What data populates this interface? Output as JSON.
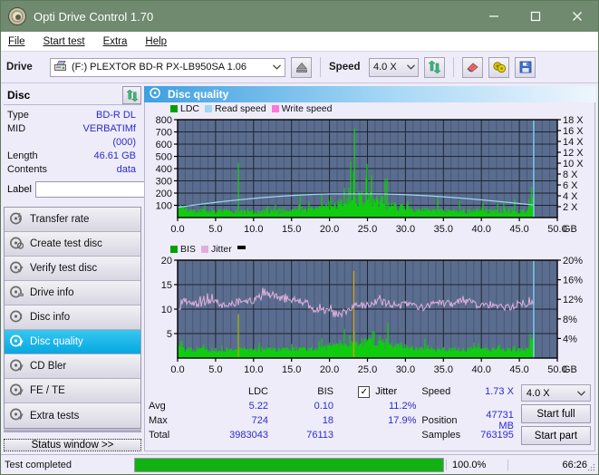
{
  "window": {
    "title": "Opti Drive Control 1.70",
    "icon": "disc-icon",
    "minimize": "minimize",
    "maximize": "maximize",
    "close": "close"
  },
  "menu": {
    "items": [
      {
        "label": "File",
        "mnemonic": "F"
      },
      {
        "label": "Start test",
        "mnemonic": "S"
      },
      {
        "label": "Extra",
        "mnemonic": "x"
      },
      {
        "label": "Help",
        "mnemonic": "H"
      }
    ]
  },
  "toolbar": {
    "drive_label": "Drive",
    "drive_value": "(F:)   PLEXTOR BD-R  PX-LB950SA 1.06",
    "drive_icon": "drive-icon",
    "eject_icon": "eject-icon",
    "speed_label": "Speed",
    "speed_value": "4.0 X",
    "refresh_icon": "refresh-icon",
    "eraser_icon": "eraser-icon",
    "bulb_icon": "bulb-icon",
    "save_icon": "save-icon"
  },
  "disc": {
    "header": "Disc",
    "refresh_icon": "refresh-icon",
    "rows": [
      {
        "key": "Type",
        "value": "BD-R DL"
      },
      {
        "key": "MID",
        "value": "VERBATIMf (000)"
      },
      {
        "key": "Length",
        "value": "46.61 GB"
      },
      {
        "key": "Contents",
        "value": "data"
      }
    ],
    "label_key": "Label",
    "label_value": "",
    "label_placeholder": "",
    "label_button_icon": "disc-icon"
  },
  "nav": {
    "items": [
      {
        "label": "Transfer rate",
        "icon": "disc-transfer-icon",
        "active": false
      },
      {
        "label": "Create test disc",
        "icon": "disc-create-icon",
        "active": false
      },
      {
        "label": "Verify test disc",
        "icon": "disc-verify-icon",
        "active": false
      },
      {
        "label": "Drive info",
        "icon": "disc-drive-icon",
        "active": false
      },
      {
        "label": "Disc info",
        "icon": "disc-info-icon",
        "active": false
      },
      {
        "label": "Disc quality",
        "icon": "disc-quality-icon",
        "active": true
      },
      {
        "label": "CD Bler",
        "icon": "disc-bler-icon",
        "active": false
      },
      {
        "label": "FE / TE",
        "icon": "disc-fete-icon",
        "active": false
      },
      {
        "label": "Extra tests",
        "icon": "disc-extra-icon",
        "active": false
      }
    ],
    "status_window": "Status window >>"
  },
  "content": {
    "header_title": "Disc quality",
    "header_icon": "disc-quality-icon"
  },
  "chart_data": [
    {
      "type": "line",
      "name": "ldc-chart",
      "title": "",
      "xlabel": "GB",
      "ylabel": "",
      "x": [
        0.0,
        5.0,
        10.0,
        15.0,
        20.0,
        25.0,
        30.0,
        35.0,
        40.0,
        45.0,
        50.0
      ],
      "xlim": [
        0,
        50
      ],
      "ylim": [
        0,
        800
      ],
      "ytick_labels": [
        "100",
        "200",
        "300",
        "400",
        "500",
        "600",
        "700",
        "800"
      ],
      "xtick_labels": [
        "0.0",
        "5.0",
        "10.0",
        "15.0",
        "20.0",
        "25.0",
        "30.0",
        "35.0",
        "40.0",
        "45.0",
        "50.0"
      ],
      "x_unit": "GB",
      "y2_tick_labels": [
        "2 X",
        "4 X",
        "6 X",
        "8 X",
        "10 X",
        "12 X",
        "14 X",
        "16 X",
        "18 X"
      ],
      "y2lim": [
        0,
        18
      ],
      "grid": true,
      "legend_position": "top-left",
      "series": [
        {
          "name": "LDC",
          "color": "#00c000",
          "type": "bar"
        },
        {
          "name": "Read speed",
          "color": "#9fd8f5",
          "type": "line"
        },
        {
          "name": "Write speed",
          "color": "#ff77dd",
          "type": "line"
        }
      ]
    },
    {
      "type": "line",
      "name": "bis-chart",
      "title": "",
      "xlabel": "GB",
      "ylabel": "",
      "xlim": [
        0,
        50
      ],
      "ylim": [
        0,
        20
      ],
      "ytick_labels": [
        "5",
        "10",
        "15",
        "20"
      ],
      "xtick_labels": [
        "0.0",
        "5.0",
        "10.0",
        "15.0",
        "20.0",
        "25.0",
        "30.0",
        "35.0",
        "40.0",
        "45.0",
        "50.0"
      ],
      "x_unit": "GB",
      "y2_tick_labels": [
        "4%",
        "8%",
        "12%",
        "16%",
        "20%"
      ],
      "y2lim": [
        0,
        20
      ],
      "grid": true,
      "legend_position": "top-left",
      "series": [
        {
          "name": "BIS",
          "color": "#00c000",
          "type": "bar"
        },
        {
          "name": "Jitter",
          "color": "#e0aedd",
          "type": "line"
        }
      ]
    }
  ],
  "stats": {
    "col_ldc": "LDC",
    "col_bis": "BIS",
    "col_jitter": "Jitter",
    "jitter_checked": true,
    "rows": [
      {
        "label": "Avg",
        "ldc": "5.22",
        "bis": "0.10",
        "jitter": "11.2%"
      },
      {
        "label": "Max",
        "ldc": "724",
        "bis": "18",
        "jitter": "17.9%"
      },
      {
        "label": "Total",
        "ldc": "3983043",
        "bis": "76113",
        "jitter": ""
      }
    ],
    "speed_label": "Speed",
    "speed_value": "1.73 X",
    "position_label": "Position",
    "position_value": "47731 MB",
    "samples_label": "Samples",
    "samples_value": "763195",
    "speed_select": "4.0 X",
    "start_full": "Start full",
    "start_part": "Start part"
  },
  "statusbar": {
    "text": "Test completed",
    "progress_percent": "100.0%",
    "progress_value": 100,
    "elapsed": "66:26"
  },
  "colors": {
    "titlebar": "#6f8a6f",
    "accent": "#06a8e0",
    "plot_bg": "#5a6d8e",
    "value_text": "#2a2ad0",
    "progress": "#12b212"
  }
}
